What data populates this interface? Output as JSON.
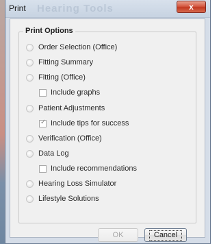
{
  "window": {
    "title": "Print",
    "ghost_title": "Hearing Tools",
    "close_symbol": "x"
  },
  "group": {
    "label": "Print Options"
  },
  "options": [
    {
      "kind": "radio",
      "label": "Order Selection (Office)"
    },
    {
      "kind": "radio",
      "label": "Fitting Summary"
    },
    {
      "kind": "radio",
      "label": "Fitting (Office)"
    },
    {
      "kind": "checkbox",
      "label": "Include graphs",
      "checked": false
    },
    {
      "kind": "radio",
      "label": "Patient Adjustments"
    },
    {
      "kind": "checkbox",
      "label": "Include tips for success",
      "checked": true
    },
    {
      "kind": "radio",
      "label": "Verification (Office)"
    },
    {
      "kind": "radio",
      "label": "Data Log"
    },
    {
      "kind": "checkbox",
      "label": "Include recommendations",
      "checked": false
    },
    {
      "kind": "radio",
      "label": "Hearing Loss Simulator"
    },
    {
      "kind": "radio",
      "label": "Lifestyle Solutions"
    }
  ],
  "buttons": {
    "ok": "OK",
    "cancel": "Cancel"
  }
}
